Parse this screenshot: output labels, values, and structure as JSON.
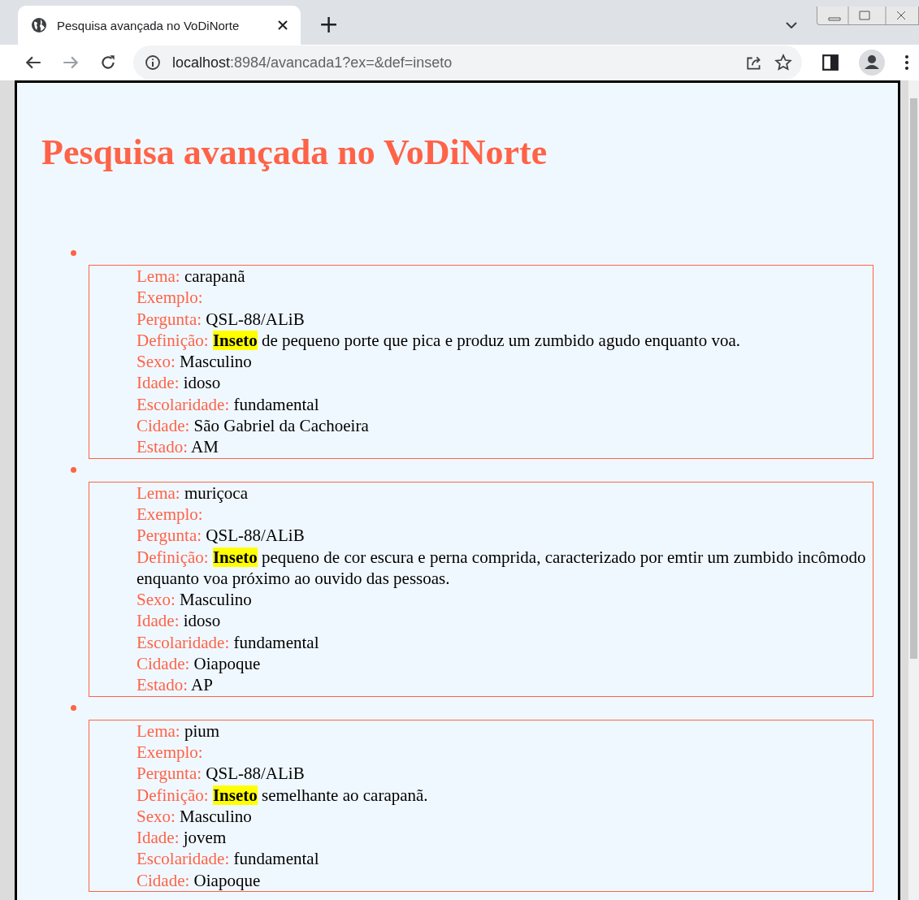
{
  "browser": {
    "tab_title": "Pesquisa avançada no VoDiNorte",
    "new_tab": "+",
    "url_host": "localhost",
    "url_path": ":8984/avancada1?ex=&def=inseto"
  },
  "page": {
    "heading": "Pesquisa avançada no VoDiNorte",
    "results": [
      {
        "fields": [
          {
            "label": "Lema:",
            "value": "carapanã"
          },
          {
            "label": "Exemplo:"
          },
          {
            "label": "Pergunta:",
            "value": "QSL-88/ALiB"
          },
          {
            "label": "Definição:",
            "term": "Inseto",
            "value": "de pequeno porte que pica e produz um zumbido agudo enquanto voa."
          },
          {
            "label": "Sexo:",
            "value": "Masculino"
          },
          {
            "label": "Idade:",
            "value": "idoso"
          },
          {
            "label": "Escolaridade:",
            "value": "fundamental"
          },
          {
            "label": "Cidade:",
            "value": "São Gabriel da Cachoeira"
          },
          {
            "label": "Estado:",
            "value": "AM"
          }
        ]
      },
      {
        "fields": [
          {
            "label": "Lema:",
            "value": "muriçoca"
          },
          {
            "label": "Exemplo:"
          },
          {
            "label": "Pergunta:",
            "value": "QSL-88/ALiB"
          },
          {
            "label": "Definição:",
            "term": "Inseto",
            "value": "pequeno de cor escura e perna comprida, caracterizado por emtir um zumbido incômodo enquanto voa próximo ao ouvido das pessoas."
          },
          {
            "label": "Sexo:",
            "value": "Masculino"
          },
          {
            "label": "Idade:",
            "value": "idoso"
          },
          {
            "label": "Escolaridade:",
            "value": "fundamental"
          },
          {
            "label": "Cidade:",
            "value": "Oiapoque"
          },
          {
            "label": "Estado:",
            "value": "AP"
          }
        ]
      },
      {
        "fields": [
          {
            "label": "Lema:",
            "value": "pium"
          },
          {
            "label": "Exemplo:"
          },
          {
            "label": "Pergunta:",
            "value": "QSL-88/ALiB"
          },
          {
            "label": "Definição:",
            "term": "Inseto",
            "value": "semelhante ao carapanã."
          },
          {
            "label": "Sexo:",
            "value": "Masculino"
          },
          {
            "label": "Idade:",
            "value": "jovem"
          },
          {
            "label": "Escolaridade:",
            "value": "fundamental"
          },
          {
            "label": "Cidade:",
            "value": "Oiapoque"
          }
        ]
      }
    ]
  }
}
